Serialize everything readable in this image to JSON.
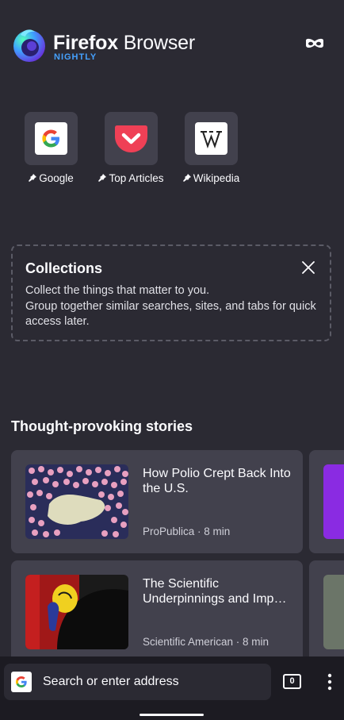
{
  "header": {
    "brand_bold": "Firefox",
    "brand_rest": " Browser",
    "brand_sub": "NIGHTLY"
  },
  "top_sites": [
    {
      "label": "Google",
      "icon": "google-icon"
    },
    {
      "label": "Top Articles",
      "icon": "pocket-icon"
    },
    {
      "label": "Wikipedia",
      "icon": "wikipedia-icon"
    }
  ],
  "collections": {
    "title": "Collections",
    "description_line1": "Collect the things that matter to you.",
    "description_line2": "Group together similar searches, sites, and tabs for quick access later."
  },
  "stories": {
    "title": "Thought-provoking stories",
    "items": [
      {
        "title": "How Polio Crept Back Into the U.S.",
        "source": "ProPublica",
        "read_time": "8 min"
      },
      {
        "title": "The Scientific Underpinnings and Imp…",
        "source": "Scientific American",
        "read_time": "8 min"
      }
    ]
  },
  "toolbar": {
    "search_placeholder": "Search or enter address",
    "tab_count": "0"
  },
  "colors": {
    "background": "#2b2a33",
    "card": "#42414d",
    "toolbar": "#1c1b22",
    "accent": "#45a1ff"
  }
}
